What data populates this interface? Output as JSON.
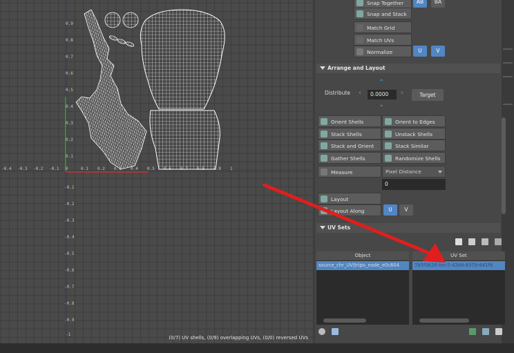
{
  "viewport": {
    "status_text": "(0/7) UV shells, (0/9) overlapping UVs, (0/0) reversed UVs",
    "x_ticks": [
      "-0.4",
      "-0.3",
      "-0.2",
      "-0.1",
      "0",
      "0.1",
      "0.2",
      "0.3",
      "0.4",
      "0.5",
      "0.6",
      "0.7",
      "0.8",
      "0.9",
      "1"
    ],
    "y_ticks_pos": [
      "0.9",
      "0.8",
      "0.7",
      "0.6",
      "0.5",
      "0.4",
      "0.3",
      "0.2",
      "0.1"
    ],
    "y_ticks_neg": [
      "-0.1",
      "-0.2",
      "-0.3",
      "-0.4",
      "-0.5",
      "-0.6",
      "-0.7",
      "-0.8",
      "-0.9",
      "-1"
    ]
  },
  "toolkit": {
    "top_buttons": {
      "snap_together": "Snap Together",
      "snap_and_stack": "Snap and Stack",
      "match_grid": "Match Grid",
      "match_uvs": "Match UVs",
      "normalize": "Normalize",
      "ab": "AB",
      "ba": "BA",
      "u": "U",
      "v": "V"
    },
    "arrange_layout": {
      "title": "Arrange and Layout",
      "distribute_label": "Distribute",
      "distribute_value": "0.0000",
      "target_button": "Target",
      "buttons": [
        "Orient Shells",
        "Orient to Edges",
        "Stack Shells",
        "Unstack Shells",
        "Gather Shells",
        "Stack and Orient",
        "Stack Similar",
        "Randomize Shells"
      ],
      "measure_label": "Measure",
      "measure_option": "Pixel Distance",
      "measure_value": "0",
      "layout_button": "Layout",
      "layout_along_button": "Layout Along",
      "u": "U",
      "v": "V"
    },
    "uv_sets": {
      "title": "UV Sets",
      "col_object": "Object",
      "col_uvset": "UV Set",
      "object_value": "source_chr_UV|tripo_node_e0c604",
      "uvset_value": "7b5f3626-bec5-42d4-837b-641f6"
    }
  },
  "colors": {
    "accent_blue": "#5285c4",
    "arrow_red": "#e01e1e",
    "uv_wire": "#ffffff"
  }
}
